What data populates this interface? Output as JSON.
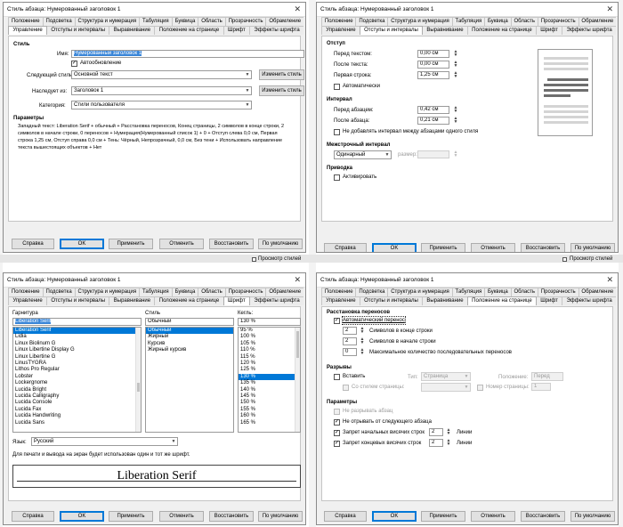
{
  "background": {
    "label": "Просмотр стилей"
  },
  "common": {
    "title": "Стиль абзаца: Нумерованный заголовок 1",
    "tabs_row1": [
      "Положение",
      "Подсветка",
      "Структура и нумерация",
      "Табуляция",
      "Буквица",
      "Область",
      "Прозрачность",
      "Обрамление"
    ],
    "tabs_row2": [
      "Управление",
      "Отступы и интервалы",
      "Выравнивание",
      "Положение на странице",
      "Шрифт",
      "Эффекты шрифта"
    ],
    "buttons": {
      "help": "Справка",
      "ok": "OK",
      "apply": "Применить",
      "cancel": "Отменить",
      "reset": "Восстановить",
      "default": "По умолчанию"
    }
  },
  "d1": {
    "section_style": "Стиль",
    "name_label": "Имя:",
    "name_value": "Нумерованный заголовок 1",
    "autoupdate": "Автообновление",
    "next_label": "Следующий стиль:",
    "next_value": "Основной текст",
    "edit_style": "Изменить стиль",
    "inherit_label": "Наследует из:",
    "inherit_value": "Заголовок 1",
    "category_label": "Категория:",
    "category_value": "Стили пользователя",
    "params_label": "Параметры",
    "params_lines": [
      "Западный текст: Liberation Serif + обычный + Расстановка переносов, Конец страницы, 2 символов в конце строки, 2",
      "символов в начале строки, 0 переносов + Нумерация(Нумерованный список 1) + 0 + Отступ слева 0,0 см, Первая",
      "строка 1,25 см, Отступ справа 0,0 см + Тень: Чёрный, Непрозрачный, 0,0 см, Без тени + Использовать направление",
      "текста вышестоящих объектов + Нет"
    ]
  },
  "d2": {
    "indent": "Отступ",
    "before": "Перед текстом:",
    "before_val": "0,00 см",
    "after": "После текста:",
    "after_val": "0,00 см",
    "first": "Первая строка:",
    "first_val": "1,25 см",
    "auto": "Автоматически",
    "interval": "Интервал",
    "above": "Перед абзацем:",
    "above_val": "0,42 см",
    "below": "После абзаца:",
    "below_val": "0,21 см",
    "noadd": "Не добавлять интервал между абзацами одного стиля",
    "line_spacing": "Межстрочный интервал",
    "line_value": "Одинарный",
    "size": "размер:",
    "register": "Приводка",
    "active": "Активировать"
  },
  "d3": {
    "family_label": "Гарнитура",
    "family_value": "Liberation Serif",
    "families": [
      "Liberation Serif",
      "Lidia",
      "Linux Biolinum G",
      "Linux Libertine Display G",
      "Linux Libertine G",
      "LinusTYGRA",
      "Lithos Pro Regular",
      "Lobster",
      "Lockergnome",
      "Lucida Bright",
      "Lucida Calligraphy",
      "Lucida Console",
      "Lucida Fax",
      "Lucida Handwriting",
      "Lucida Sans"
    ],
    "style_label": "Стиль",
    "style_value": "Обычный",
    "styles": [
      "Обычный",
      "Жирный",
      "Курсив",
      "Жирный курсив"
    ],
    "size_label": "Кегль:",
    "size_value": "130 %",
    "sizes": [
      "95 %",
      "100 %",
      "105 %",
      "110 %",
      "115 %",
      "120 %",
      "125 %",
      "130 %",
      "135 %",
      "140 %",
      "145 %",
      "150 %",
      "155 %",
      "160 %",
      "165 %"
    ],
    "lang_label": "Язык:",
    "lang_value": "Русский",
    "note": "Для печати и вывода на экран будет использован один и тот же шрифт.",
    "preview": "Liberation Serif"
  },
  "d4": {
    "hyph": "Расстановка переносов",
    "auto_hyph": "Автоматический перенос",
    "end_val": "2",
    "end_lbl": "Символов в конце строки",
    "start_val": "2",
    "start_lbl": "Символов в начале строки",
    "max_val": "0",
    "max_lbl": "Максимальное количество последовательных переносов",
    "breaks": "Разрывы",
    "insert": "Вставить",
    "type_lbl": "Тип:",
    "type_val": "Страница",
    "pos_lbl": "Положение:",
    "pos_val": "Перед",
    "with_style": "Со стилем страницы:",
    "page_num": "Номер страницы:",
    "page_num_val": "1",
    "params": "Параметры",
    "nosplit": "Не разрывать абзац",
    "keep": "Не отрывать от следующего абзаца",
    "orphan": "Запрет начальных висячих строк",
    "orphan_val": "2",
    "widow": "Запрет концевых висячих строк",
    "widow_val": "2",
    "lines": "Линии"
  }
}
